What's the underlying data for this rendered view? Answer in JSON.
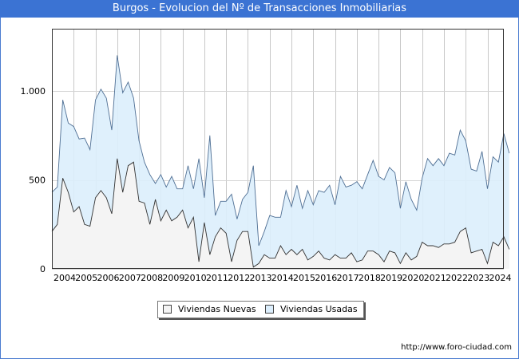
{
  "title": "Burgos - Evolucion del Nº de Transacciones Inmobiliarias",
  "source_url": "http://www.foro-ciudad.com",
  "colors": {
    "title_bg": "#3b73d3",
    "plot_bg": "#ebebeb",
    "usadas_fill": "#dceefc",
    "usadas_line": "#4f6f94",
    "nuevas_fill": "#f4f4f4",
    "nuevas_line": "#333333"
  },
  "chart_data": {
    "type": "area",
    "grid": true,
    "legend_position": "bottom-center",
    "ylim": [
      0,
      1350
    ],
    "yticks": [
      0,
      500,
      1000
    ],
    "ytick_labels": [
      "0",
      "500",
      "1.000"
    ],
    "xlim": [
      2004,
      2024.75
    ],
    "xticks": [
      2004,
      2005,
      2006,
      2007,
      2008,
      2009,
      2010,
      2011,
      2012,
      2013,
      2014,
      2015,
      2016,
      2017,
      2018,
      2019,
      2020,
      2021,
      2022,
      2023,
      2024
    ],
    "xtick_labels": [
      "2004",
      "2005",
      "2006",
      "2007",
      "2008",
      "2009",
      "2010",
      "2011",
      "2012",
      "2013",
      "2014",
      "2015",
      "2016",
      "2017",
      "2018",
      "2019",
      "2020",
      "2021",
      "2022",
      "2023",
      "2024"
    ],
    "x_step": 0.25,
    "series": [
      {
        "name": "Viviendas Usadas",
        "stacked_total": true,
        "values": [
          430,
          460,
          950,
          820,
          800,
          730,
          735,
          670,
          950,
          1010,
          960,
          780,
          1200,
          990,
          1050,
          960,
          720,
          600,
          530,
          480,
          530,
          460,
          520,
          450,
          450,
          580,
          450,
          620,
          400,
          750,
          300,
          380,
          380,
          420,
          280,
          390,
          430,
          580,
          130,
          210,
          300,
          290,
          290,
          440,
          350,
          470,
          340,
          440,
          360,
          440,
          430,
          470,
          360,
          520,
          460,
          470,
          490,
          450,
          530,
          610,
          520,
          500,
          570,
          540,
          340,
          490,
          390,
          330,
          510,
          620,
          580,
          620,
          580,
          650,
          640,
          780,
          720,
          560,
          550,
          660,
          450,
          630,
          600,
          760,
          650
        ]
      },
      {
        "name": "Viviendas Nuevas",
        "values": [
          210,
          250,
          510,
          430,
          320,
          350,
          250,
          240,
          400,
          440,
          400,
          310,
          620,
          430,
          580,
          600,
          380,
          370,
          250,
          390,
          270,
          330,
          270,
          290,
          330,
          230,
          290,
          40,
          260,
          80,
          180,
          230,
          200,
          40,
          160,
          210,
          210,
          10,
          30,
          80,
          60,
          60,
          130,
          80,
          110,
          80,
          110,
          50,
          70,
          100,
          60,
          50,
          80,
          60,
          60,
          90,
          40,
          50,
          100,
          100,
          80,
          40,
          100,
          90,
          30,
          90,
          50,
          70,
          150,
          130,
          130,
          120,
          140,
          140,
          150,
          210,
          230,
          90,
          100,
          110,
          30,
          150,
          130,
          180,
          110
        ]
      }
    ]
  },
  "legend": {
    "items": [
      {
        "label": "Viviendas Nuevas",
        "color": "#f4f4f4"
      },
      {
        "label": "Viviendas Usadas",
        "color": "#dceefc"
      }
    ]
  }
}
